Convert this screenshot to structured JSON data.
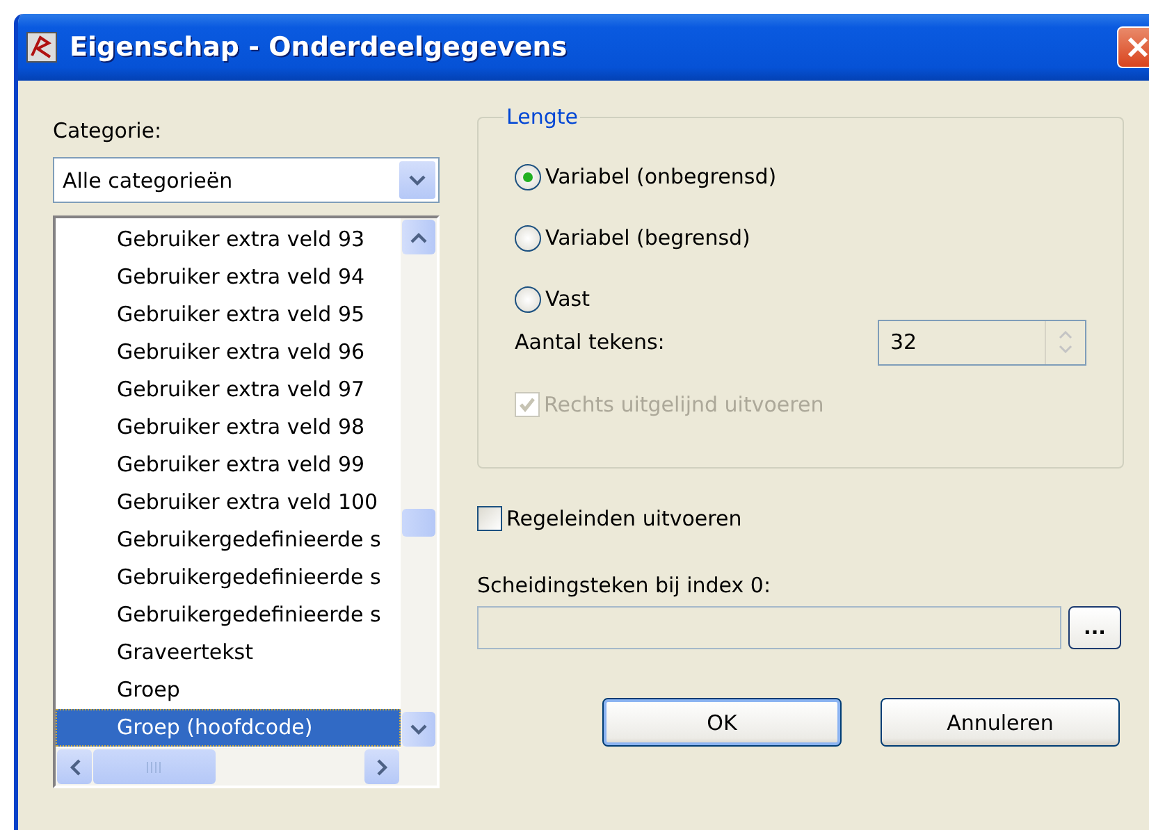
{
  "window": {
    "title": "Eigenschap - Onderdeelgegevens"
  },
  "category": {
    "label": "Categorie:",
    "value": "Alle categorieën"
  },
  "list": {
    "items": [
      {
        "label": "Gebruiker extra veld 93",
        "selected": false
      },
      {
        "label": "Gebruiker extra veld 94",
        "selected": false
      },
      {
        "label": "Gebruiker extra veld 95",
        "selected": false
      },
      {
        "label": "Gebruiker extra veld 96",
        "selected": false
      },
      {
        "label": "Gebruiker extra veld 97",
        "selected": false
      },
      {
        "label": "Gebruiker extra veld 98",
        "selected": false
      },
      {
        "label": "Gebruiker extra veld 99",
        "selected": false
      },
      {
        "label": "Gebruiker extra veld 100",
        "selected": false
      },
      {
        "label": "Gebruikergedefinieerde s",
        "selected": false
      },
      {
        "label": "Gebruikergedefinieerde s",
        "selected": false
      },
      {
        "label": "Gebruikergedefinieerde s",
        "selected": false
      },
      {
        "label": "Graveertekst",
        "selected": false
      },
      {
        "label": "Groep",
        "selected": false
      },
      {
        "label": "Groep (hoofdcode)",
        "selected": true
      }
    ]
  },
  "length": {
    "legend": "Lengte",
    "options": [
      {
        "label": "Variabel (onbegrensd)",
        "selected": true
      },
      {
        "label": "Variabel (begrensd)",
        "selected": false
      },
      {
        "label": "Vast",
        "selected": false
      }
    ],
    "count_label": "Aantal tekens:",
    "count_value": "32",
    "right_aligned": {
      "label": "Rechts uitgelijnd uitvoeren",
      "checked": true,
      "disabled": true
    }
  },
  "line_endings": {
    "label": "Regeleinden uitvoeren",
    "checked": false
  },
  "separator": {
    "label": "Scheidingsteken bij index 0:",
    "browse": "..."
  },
  "buttons": [
    {
      "label": "OK",
      "default": true
    },
    {
      "label": "Annuleren",
      "default": false
    }
  ]
}
